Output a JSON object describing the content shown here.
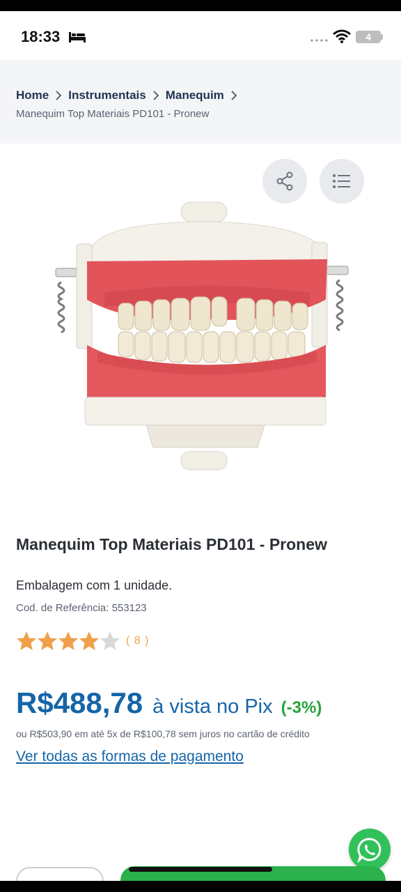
{
  "status": {
    "time": "18:33",
    "battery": "4"
  },
  "breadcrumb": {
    "items": [
      "Home",
      "Instrumentais",
      "Manequim"
    ],
    "current": "Manequim Top Materiais PD101 - Pronew"
  },
  "product": {
    "title": "Manequim Top Materiais PD101 - Pronew",
    "packaging": "Embalagem com 1 unidade.",
    "reference": "Cod. de Referência: 553123",
    "rating": 4.5,
    "rating_count": "( 8 )",
    "price": "R$488,78",
    "pix_label": "à vista no Pix",
    "discount": "(-3%)",
    "installments": "ou R$503,90 em até 5x de R$100,78 sem juros no cartão de crédito",
    "payment_link": "Ver todas as formas de pagamento"
  },
  "icons": {
    "share": "share-icon",
    "list": "list-icon",
    "whatsapp": "whatsapp-icon",
    "star": "star-icon"
  },
  "colors": {
    "price": "#1565a8",
    "discount": "#26a33b",
    "star": "#f0a04a",
    "whatsapp": "#31c15a"
  }
}
